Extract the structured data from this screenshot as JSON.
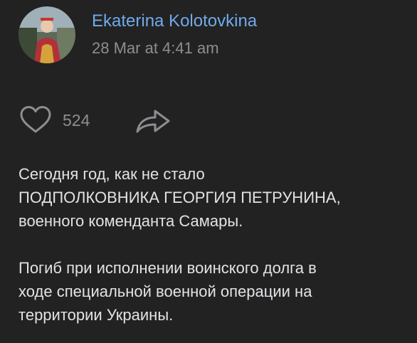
{
  "post": {
    "author": "Ekaterina Kolotovkina",
    "timestamp": "28 Mar at 4:41 am",
    "likes": "524",
    "paragraphs": [
      [
        "Сегодня год, как не стало",
        "ПОДПОЛКОВНИКА ГЕОРГИЯ ПЕТРУНИНА,",
        "военного коменданта Самары."
      ],
      [
        "Погиб при исполнении воинского долга в",
        "ходе специальной военной операции на",
        "территории Украины."
      ]
    ]
  },
  "icons": {
    "avatar": "avatar",
    "like": "heart-icon",
    "share": "share-icon"
  },
  "colors": {
    "background": "#222222",
    "author_link": "#71aaeb",
    "secondary_text": "#8c8e91",
    "primary_text": "#e1e3e6"
  }
}
